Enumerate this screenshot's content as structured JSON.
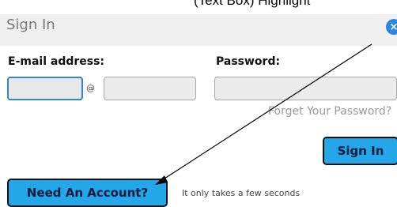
{
  "annotation": {
    "caption_fragment": "(Text Box) Highlight"
  },
  "dialog": {
    "title": "Sign In",
    "close_glyph": "×",
    "email": {
      "label": "E-mail address:",
      "local_value": "",
      "at_symbol": "@",
      "domain_value": ""
    },
    "password": {
      "label": "Password:",
      "value": ""
    },
    "forgot_link": "Forget Your Password?",
    "sign_in_button": "Sign In",
    "need_account_button": "Need An Account?",
    "need_account_hint": "It only takes a few seconds"
  },
  "colors": {
    "accent_button": "#23a7e8",
    "focus_border": "#2f87d2",
    "close_button": "#2a86e0"
  }
}
